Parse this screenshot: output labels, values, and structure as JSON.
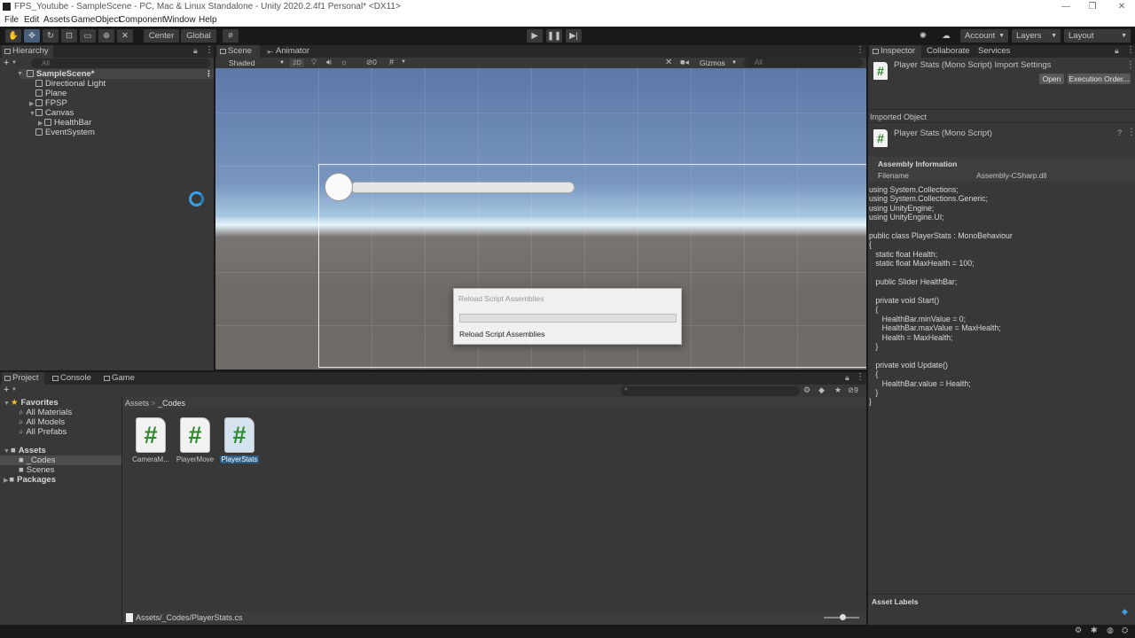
{
  "window": {
    "title": "FPS_Youtube - SampleScene - PC, Mac & Linux Standalone - Unity 2020.2.4f1 Personal* <DX11>",
    "controls": [
      "—",
      "❐",
      "✕"
    ]
  },
  "menu": [
    "File",
    "Edit",
    "Assets",
    "GameObject",
    "Component",
    "Window",
    "Help"
  ],
  "toolbar": {
    "pivot_label": "Center",
    "space_label": "Global",
    "account_label": "Account",
    "layers_label": "Layers",
    "layout_label": "Layout"
  },
  "hierarchy": {
    "tab_label": "Hierarchy",
    "search_placeholder": "All",
    "scene_name": "SampleScene*",
    "items": [
      {
        "label": "Directional Light"
      },
      {
        "label": "Plane"
      },
      {
        "label": "FPSP"
      },
      {
        "label": "Canvas"
      },
      {
        "label": "HealthBar"
      },
      {
        "label": "EventSystem"
      }
    ]
  },
  "scene": {
    "tabs": [
      "Scene",
      "Animator"
    ],
    "shading_mode": "Shaded",
    "mode_2d": "2D",
    "hidden_count": "0",
    "gizmos_label": "Gizmos",
    "search_placeholder": "All"
  },
  "dialog": {
    "title": "Reload Script Assemblies",
    "status": "Reload Script Assemblies",
    "progress": 0
  },
  "bottom_tabs": [
    "Project",
    "Console",
    "Game"
  ],
  "project": {
    "favorites_label": "Favorites",
    "favorites": [
      "All Materials",
      "All Models",
      "All Prefabs"
    ],
    "assets_label": "Assets",
    "asset_folders": [
      "_Codes",
      "Scenes"
    ],
    "packages_label": "Packages",
    "breadcrumb": [
      "Assets",
      "_Codes"
    ],
    "breadcrumb_sep": ">",
    "files": [
      {
        "name": "CameraM...",
        "glyph": "#"
      },
      {
        "name": "PlayerMove",
        "glyph": "#"
      },
      {
        "name": "PlayerStats",
        "glyph": "#"
      }
    ],
    "selected_path": "Assets/_Codes/PlayerStats.cs",
    "hidden_count": "9"
  },
  "inspector": {
    "tabs": [
      "Inspector",
      "Collaborate",
      "Services"
    ],
    "import_title": "Player Stats (Mono Script) Import Settings",
    "open_label": "Open",
    "exec_order_label": "Execution Order...",
    "imported_object_label": "Imported Object",
    "object_title": "Player Stats (Mono Script)",
    "assembly_info_label": "Assembly Information",
    "filename_label": "Filename",
    "filename_value": "Assembly-CSharp.dll",
    "asset_labels": "Asset Labels",
    "code_lines": [
      "using System.Collections;",
      "using System.Collections.Generic;",
      "using UnityEngine;",
      "using UnityEngine.UI;",
      "",
      "public class PlayerStats : MonoBehaviour",
      "{",
      "   static float Health;",
      "   static float MaxHealth = 100;",
      "",
      "   public Slider HealthBar;",
      "",
      "   private void Start()",
      "   {",
      "      HealthBar.minValue = 0;",
      "      HealthBar.maxValue = MaxHealth;",
      "      Health = MaxHealth;",
      "   }",
      "",
      "   private void Update()",
      "   {",
      "      HealthBar.value = Health;",
      "   }",
      "}"
    ]
  },
  "colors": {
    "selection": "#2c5d87",
    "script_hash": "#2d8a2d",
    "loading_ring": "#3aa0e8"
  }
}
